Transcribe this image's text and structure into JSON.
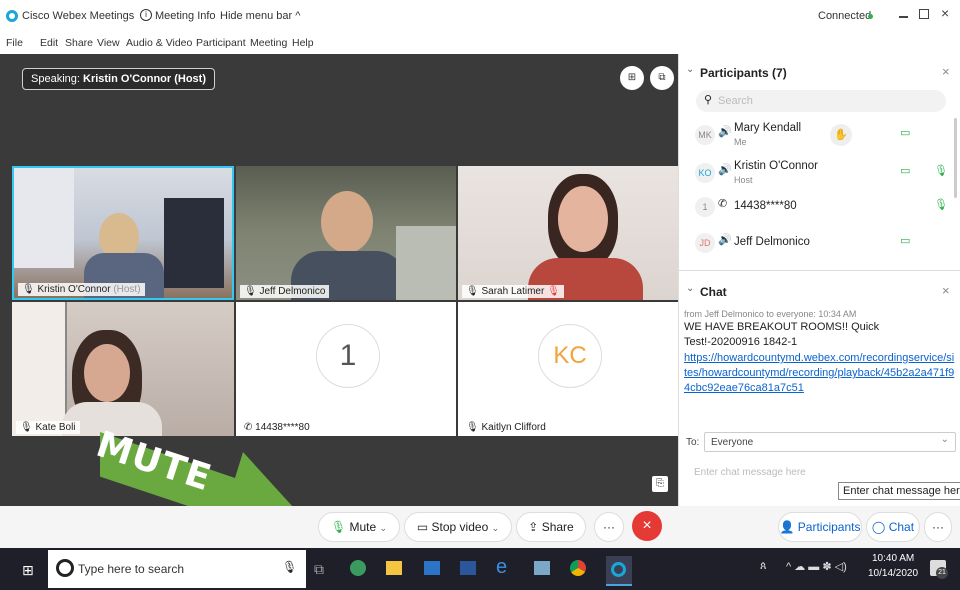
{
  "titlebar": {
    "app": "Cisco Webex Meetings",
    "info": "Meeting Info",
    "hide": "Hide menu bar ^",
    "status": "Connected"
  },
  "menu": [
    "File",
    "Edit",
    "Share",
    "View",
    "Audio & Video",
    "Participant",
    "Meeting",
    "Help"
  ],
  "stage": {
    "speaking_prefix": "Speaking:",
    "speaking_name": "Kristin O'Connor (Host)"
  },
  "tiles": [
    {
      "name": "Kristin O'Connor",
      "suffix": "(Host)"
    },
    {
      "name": "Jeff Delmonico"
    },
    {
      "name": "Sarah Latimer"
    },
    {
      "name": "Kate Boli"
    },
    {
      "name": "14438****80",
      "big": "1"
    },
    {
      "name": "Kaitlyn Clifford",
      "big": "KC"
    }
  ],
  "annotation": {
    "text": "MUTE",
    "color": "#6aa840"
  },
  "controls": {
    "mute": "Mute",
    "stop_video": "Stop video",
    "share": "Share",
    "more": "···",
    "participants": "Participants",
    "chat": "Chat",
    "end_color": "#e53935"
  },
  "participants": {
    "title": "Participants (7)",
    "search_placeholder": "Search",
    "list": [
      {
        "initials": "MK",
        "name": "Mary Kendall",
        "role": "Me"
      },
      {
        "initials": "KO",
        "name": "Kristin O'Connor",
        "role": "Host"
      },
      {
        "initials": "1",
        "name": "14438****80",
        "role": ""
      },
      {
        "initials": "JD",
        "name": "Jeff Delmonico",
        "role": ""
      }
    ]
  },
  "chat": {
    "title": "Chat",
    "meta": "from Jeff Delmonico to everyone:   10:34 AM",
    "message": "WE HAVE BREAKOUT ROOMS!! Quick Test!-20200916 1842-1",
    "link": "https://howardcountymd.webex.com/recordingservice/sites/howardcountymd/recording/playback/45b2a2a471f94cbc92eae76ca81a7c51",
    "to_label": "To:",
    "to_value": "Everyone",
    "input_placeholder": "Enter chat message here",
    "tooltip": "Enter chat message here"
  },
  "taskbar": {
    "search": "Type here to search",
    "time": "10:40 AM",
    "date": "10/14/2020",
    "notif": "21"
  }
}
